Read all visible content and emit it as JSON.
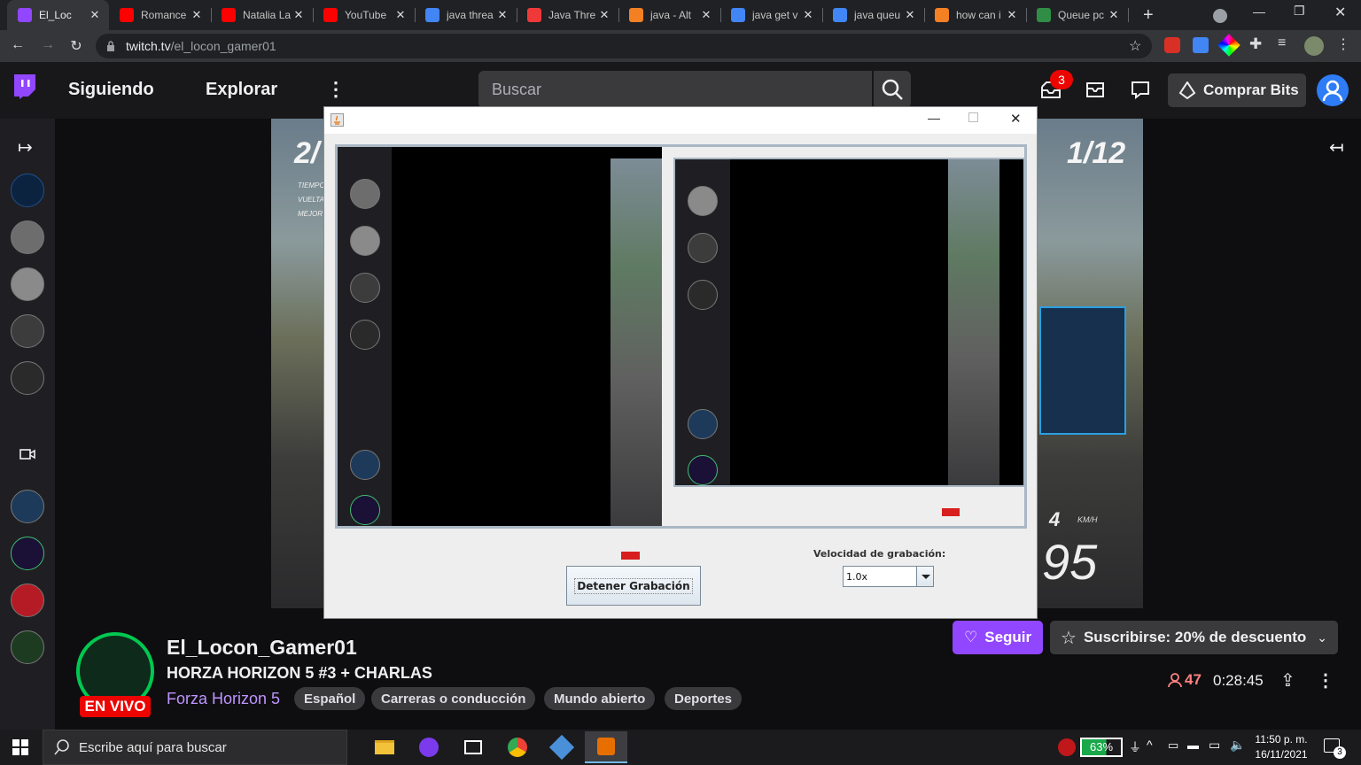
{
  "browser": {
    "tabs": [
      {
        "title": "El_Loc",
        "icon": "twitch-icon",
        "color": "#9146ff",
        "active": true
      },
      {
        "title": "Romance",
        "icon": "youtube-icon",
        "color": "#ff0000"
      },
      {
        "title": "Natalia La",
        "icon": "youtube-icon",
        "color": "#ff0000"
      },
      {
        "title": "YouTube",
        "icon": "youtube-icon",
        "color": "#ff0000"
      },
      {
        "title": "java threa",
        "icon": "google-icon",
        "color": "#4285f4"
      },
      {
        "title": "Java Thre",
        "icon": "vivaldi-icon",
        "color": "#ef3939"
      },
      {
        "title": "java - Alt",
        "icon": "stackoverflow-icon",
        "color": "#f48024"
      },
      {
        "title": "java get v",
        "icon": "google-icon",
        "color": "#4285f4"
      },
      {
        "title": "java queu",
        "icon": "google-icon",
        "color": "#4285f4"
      },
      {
        "title": "how can i",
        "icon": "stackoverflow-icon",
        "color": "#f48024"
      },
      {
        "title": "Queue pc",
        "icon": "geeksforgeeks-icon",
        "color": "#2f8d46"
      }
    ],
    "new_tab": "+",
    "url_host": "twitch.tv",
    "url_path": "/el_locon_gamer01"
  },
  "twitch": {
    "nav": {
      "following": "Siguiendo",
      "browse": "Explorar",
      "search_placeholder": "Buscar",
      "notifications_count": "3",
      "buy_bits": "Comprar Bits"
    },
    "channel": {
      "name": "El_Locon_Gamer01",
      "title": "HORZA HORIZON 5 #3 + CHARLAS",
      "game": "Forza Horizon 5",
      "live_badge": "EN VIVO",
      "tags": [
        "Español",
        "Carreras o conducción",
        "Mundo abierto",
        "Deportes"
      ],
      "follow": "Seguir",
      "subscribe": "Suscribirse: 20% de descuento",
      "viewers": "47",
      "uptime": "0:28:45"
    },
    "video_overlay": {
      "position": "1/12",
      "position_left": "2/",
      "labels": [
        "TIEMPO",
        "VUELTA",
        "MEJOR"
      ],
      "speed_gear": "4",
      "speed_unit": "KM/H",
      "speed_value": "95"
    }
  },
  "java_app": {
    "record_speed_label": "Velocidad de grabación:",
    "record_speed_value": "1.0x",
    "stop_button": "Detener Grabación"
  },
  "taskbar": {
    "search_placeholder": "Escribe aquí para buscar",
    "battery": "63%",
    "time": "11:50 p. m.",
    "date": "16/11/2021",
    "notifications": "3"
  }
}
